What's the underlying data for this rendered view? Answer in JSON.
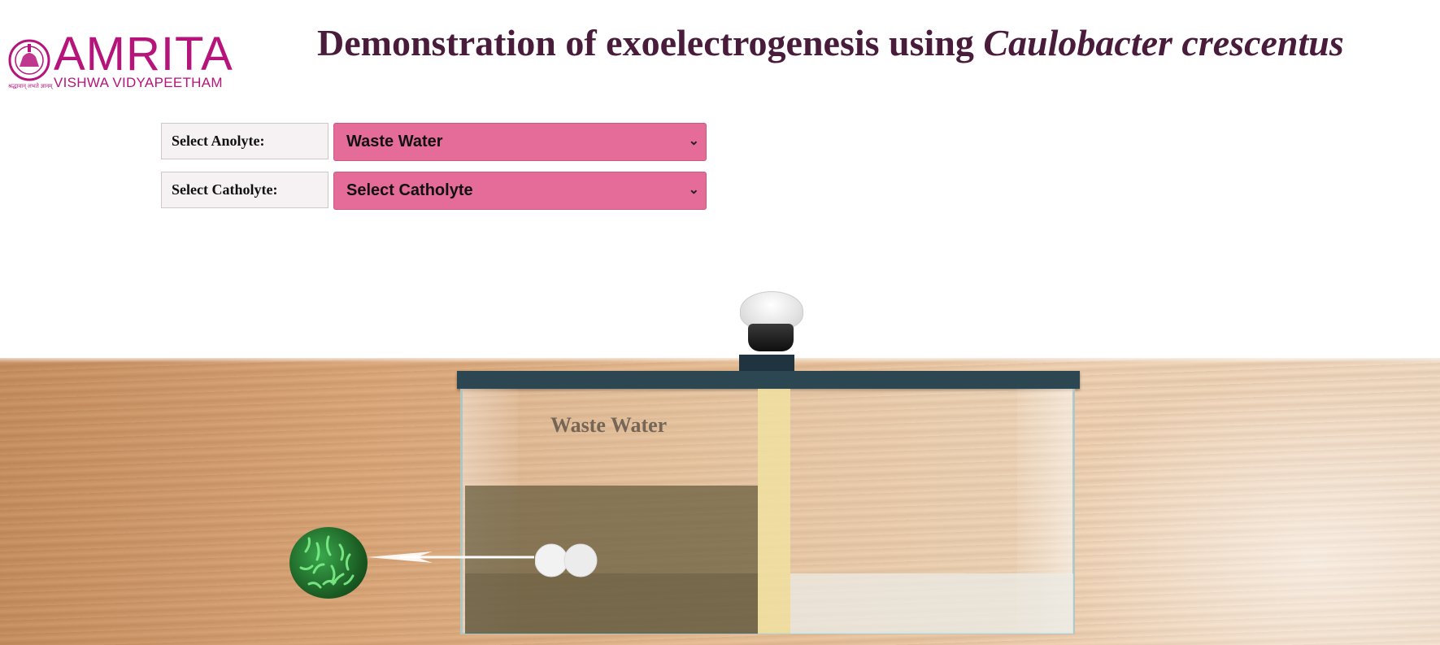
{
  "logo": {
    "word": "AMRITA",
    "subtitle": "VISHWA VIDYAPEETHAM",
    "tagline": "श्रद्धावान् लभते ज्ञानम्",
    "color": "#b5157a"
  },
  "title": {
    "main": "Demonstration of exoelectrogenesis using ",
    "organism": "Caulobacter crescentus"
  },
  "controls": {
    "anolyte": {
      "label": "Select Anolyte:",
      "selected": "Waste Water"
    },
    "catholyte": {
      "label": "Select Catholyte:",
      "selected": "Select Catholyte"
    }
  },
  "scene": {
    "anolyte_label": "Waste Water",
    "icons": [
      "light-bulb-icon",
      "microbe-icon",
      "electrode-icon"
    ]
  },
  "colors": {
    "title": "#4a1c3c",
    "select_bg": "#e56c99",
    "lid": "#2c4752"
  }
}
